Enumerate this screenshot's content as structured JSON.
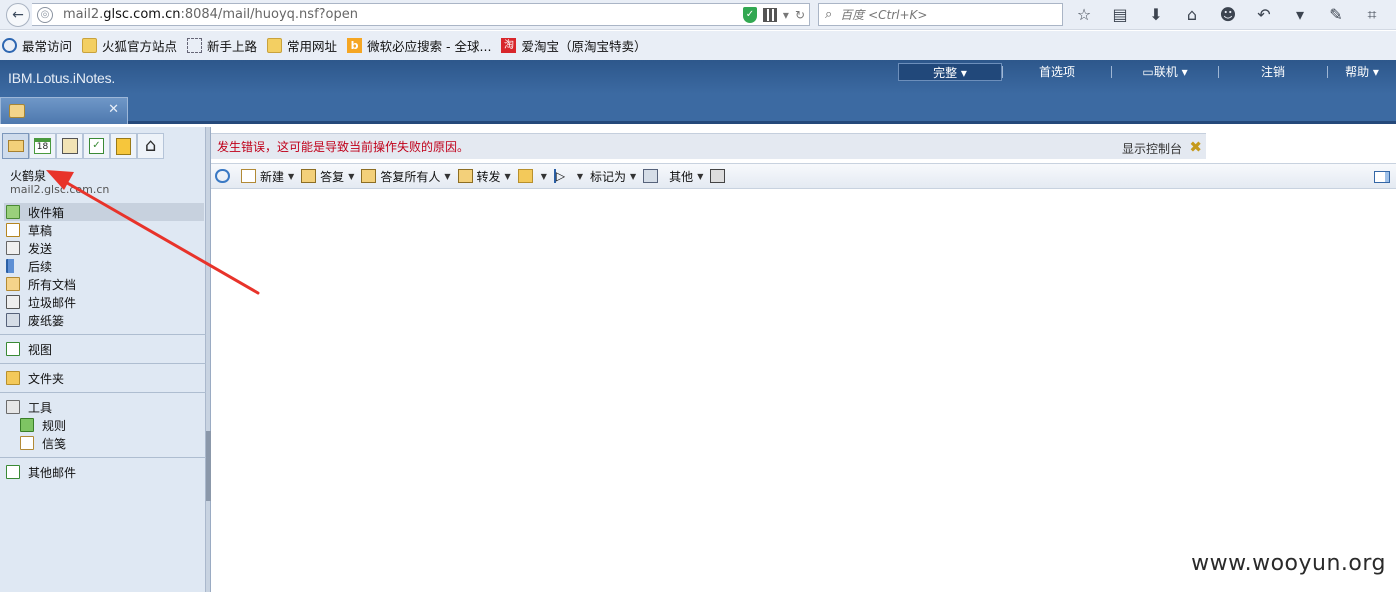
{
  "browser": {
    "url_prefix": "mail2.",
    "url_host": "glsc.com.cn",
    "url_rest": ":8084/mail/huoyq.nsf?open",
    "search_placeholder": "百度 <Ctrl+K>"
  },
  "bookmarks": [
    {
      "label": "最常访问"
    },
    {
      "label": "火狐官方站点"
    },
    {
      "label": "新手上路"
    },
    {
      "label": "常用网址"
    },
    {
      "label": "微软必应搜索 - 全球..."
    },
    {
      "label": "爱淘宝（原淘宝特卖）"
    }
  ],
  "app": {
    "brand": "IBM.Lotus.iNotes.",
    "menu": {
      "full": "完整 ▾",
      "preferences": "首选项",
      "online": "联机 ▾",
      "logout": "注销",
      "help": "帮助 ▾"
    },
    "tab_close": "✕"
  },
  "sidebar": {
    "user_name": "火鹤泉",
    "user_email": "mail2.glsc.com.cn",
    "mail_folders": [
      {
        "label": "收件箱"
      },
      {
        "label": "草稿"
      },
      {
        "label": "发送"
      },
      {
        "label": "后续"
      },
      {
        "label": "所有文档"
      },
      {
        "label": "垃圾邮件"
      },
      {
        "label": "废纸篓"
      }
    ],
    "views_label": "视图",
    "folders_label": "文件夹",
    "tools_label": "工具",
    "tools_items": [
      {
        "label": "规则"
      },
      {
        "label": "信笺"
      }
    ],
    "other_mail_label": "其他邮件",
    "calendar_day": "18"
  },
  "main": {
    "error_text": "发生错误，这可能是导致当前操作失败的原因。",
    "console_link": "显示控制台",
    "actions": {
      "new": "新建",
      "reply": "答复",
      "reply_all": "答复所有人",
      "forward": "转发",
      "mark_as": "标记为",
      "more": "其他"
    }
  },
  "watermark": "www.wooyun.org",
  "colors": {
    "header_blue": "#2d578b",
    "error_red": "#c0001a",
    "annotation_red": "#e8332a"
  }
}
